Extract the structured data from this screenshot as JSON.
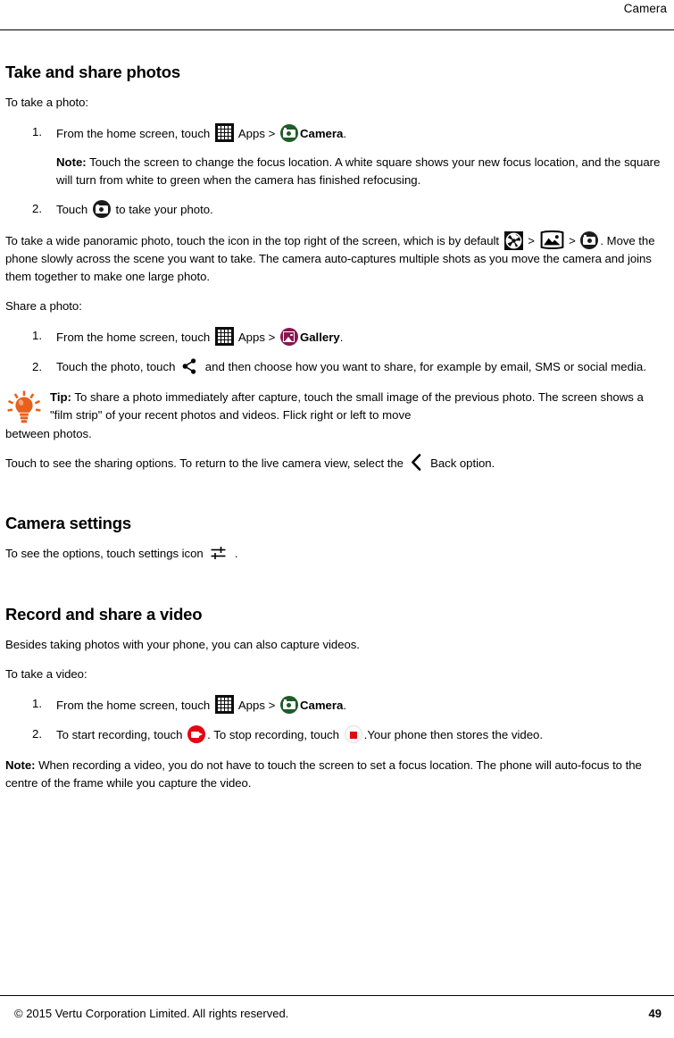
{
  "header": {
    "title": "Camera"
  },
  "footer": {
    "copyright": "© 2015 Vertu Corporation Limited. All rights reserved.",
    "page_number": "49"
  },
  "sections": {
    "take_and_share": {
      "heading": "Take and share photos",
      "intro": "To take a photo:",
      "step1_pre": "From the home screen, touch",
      "step1_mid": "Apps >",
      "step1_app": "Camera",
      "step1_end": ".",
      "note_label": "Note:",
      "note_text": "Touch the screen to change the focus location. A white square shows your new focus location, and the square will turn from white to green when the camera has finished refocusing.",
      "step2_pre": "Touch",
      "step2_post": "to take your photo.",
      "pano_part1": "To take a wide panoramic photo, touch the icon in the top right of the screen, which is by default",
      "pano_gt1": ">",
      "pano_gt2": ">",
      "pano_part2": ". Move the phone slowly across the scene you want to take. The camera auto-captures multiple shots as you move the camera and joins them together to make one large photo.",
      "share_intro": "Share a photo:",
      "share_step1_pre": "From the home screen, touch",
      "share_step1_mid": "Apps >",
      "share_step1_app": "Gallery",
      "share_step1_end": ".",
      "share_step2_pre": "Touch the photo, touch",
      "share_step2_post": "and then choose how you want to share, for example by email, SMS or social media.",
      "tip_label": "Tip:",
      "tip_text": "To share a photo immediately after capture, touch the small image of the previous photo. The screen shows a \"film strip\" of your recent photos and videos. Flick right or left to move",
      "tip_text_last": "between photos.",
      "back_pre": "Touch to see the sharing options. To return to the live camera view, select the",
      "back_post": "Back option."
    },
    "camera_settings": {
      "heading": "Camera settings",
      "text_pre": "To see the options, touch settings icon",
      "text_post": "."
    },
    "record_video": {
      "heading": "Record and share a video",
      "intro1": "Besides taking photos with your phone, you can also capture videos.",
      "intro2": "To take a video:",
      "step1_pre": "From the home screen, touch",
      "step1_mid": "Apps >",
      "step1_app": "Camera",
      "step1_end": ".",
      "step2_pre": "To start recording, touch",
      "step2_mid": ". To stop recording, touch",
      "step2_post": ".Your phone then stores the video.",
      "note_label": "Note:",
      "note_text": "When recording a video, you do not have to touch the screen to set a focus location. The phone will auto-focus to the centre of the frame while you capture the video."
    }
  },
  "icons": {
    "apps": "apps-grid-icon",
    "camera_app": "camera-app-icon",
    "shutter": "camera-shutter-icon",
    "aperture": "aperture-mode-icon",
    "panorama": "panorama-mode-icon",
    "gallery": "gallery-app-icon",
    "share": "share-icon",
    "back": "back-chevron-icon",
    "settings": "settings-sliders-icon",
    "record": "video-record-icon",
    "stop": "video-stop-icon",
    "tip_bulb": "lightbulb-tip-icon"
  },
  "colors": {
    "camera_green": "#1f5c28",
    "gallery_magenta": "#8a1550",
    "record_red": "#e30613",
    "tip_orange": "#e8601c",
    "text": "#000000",
    "page_background": "#ffffff"
  }
}
